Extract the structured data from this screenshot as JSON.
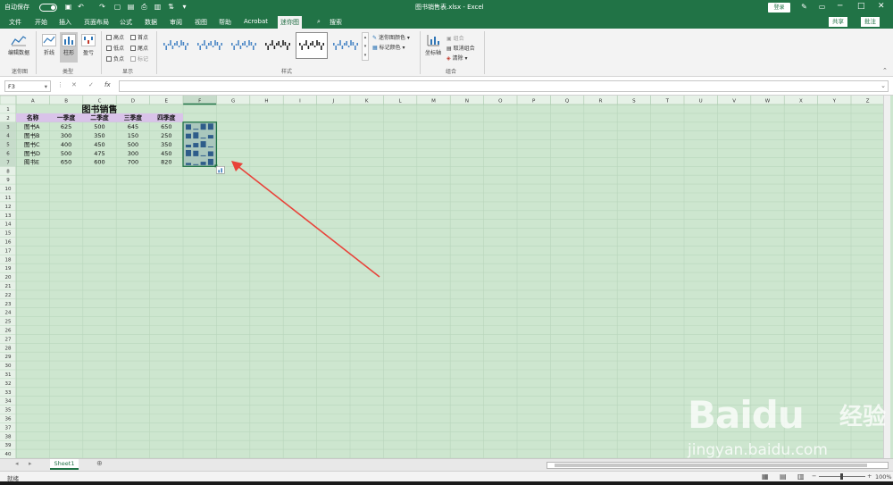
{
  "titlebar": {
    "autosave_label": "自动保存",
    "doc_title": "图书销售表.xlsx - Excel",
    "login_label": "登录",
    "controls": [
      "─",
      "□",
      "✕"
    ]
  },
  "tabs": [
    "文件",
    "开始",
    "插入",
    "页面布局",
    "公式",
    "数据",
    "审阅",
    "视图",
    "帮助",
    "Acrobat",
    "迷你图",
    "搜索"
  ],
  "active_tab": "迷你图",
  "share_label": "共享",
  "comment_label": "批注",
  "ribbon": {
    "edit_data": "编辑数据",
    "group_sparkline": "迷你图",
    "type_line": "折线",
    "type_column": "柱形",
    "type_winloss": "盈亏",
    "group_type": "类型",
    "checks": [
      {
        "label": "高点",
        "checked": false
      },
      {
        "label": "首点",
        "checked": false
      },
      {
        "label": "低点",
        "checked": false
      },
      {
        "label": "尾点",
        "checked": false
      },
      {
        "label": "负点",
        "checked": false
      },
      {
        "label": "标记",
        "checked": false
      }
    ],
    "group_show": "显示",
    "group_style": "样式",
    "sparkline_color": "迷你图颜色",
    "marker_color": "标记颜色",
    "axis": "坐标轴",
    "group_btn": "组合",
    "ungroup_btn": "取消组合",
    "clear_btn": "清除",
    "group_combine": "组合"
  },
  "formulabar": {
    "namebox": "F3",
    "fx": "fx",
    "value": ""
  },
  "columns": [
    "A",
    "B",
    "C",
    "D",
    "E",
    "F",
    "G",
    "H",
    "I",
    "J",
    "K",
    "L",
    "M",
    "N",
    "O",
    "P",
    "Q",
    "R",
    "S",
    "T",
    "U",
    "V",
    "W",
    "X",
    "Y",
    "Z"
  ],
  "row_count": 40,
  "selected_col": "F",
  "sheet": {
    "title": "图书销售",
    "headers": [
      "名称",
      "一季度",
      "二季度",
      "三季度",
      "四季度"
    ],
    "rows": [
      [
        "图书A",
        "625",
        "500",
        "645",
        "650"
      ],
      [
        "图书B",
        "300",
        "350",
        "150",
        "250"
      ],
      [
        "图书C",
        "400",
        "450",
        "500",
        "350"
      ],
      [
        "图书D",
        "500",
        "475",
        "300",
        "450"
      ],
      [
        "图书E",
        "650",
        "600",
        "700",
        "820"
      ]
    ]
  },
  "sparkline_values": [
    [
      625,
      500,
      645,
      650
    ],
    [
      300,
      350,
      150,
      250
    ],
    [
      400,
      450,
      500,
      350
    ],
    [
      500,
      475,
      300,
      450
    ],
    [
      650,
      600,
      700,
      820
    ]
  ],
  "colors": {
    "excel_green": "#217346",
    "sheet_bg": "#cde6cf",
    "header_fill": "#d9c3e9",
    "sparkline": "#2e5c8a",
    "arrow": "#e8433a"
  },
  "sheet_tab": "Sheet1",
  "status": {
    "left": "就绪",
    "zoom": "100%"
  },
  "watermark": {
    "logo": "Baidu",
    "cn": "经验",
    "url": "jingyan.baidu.com"
  }
}
